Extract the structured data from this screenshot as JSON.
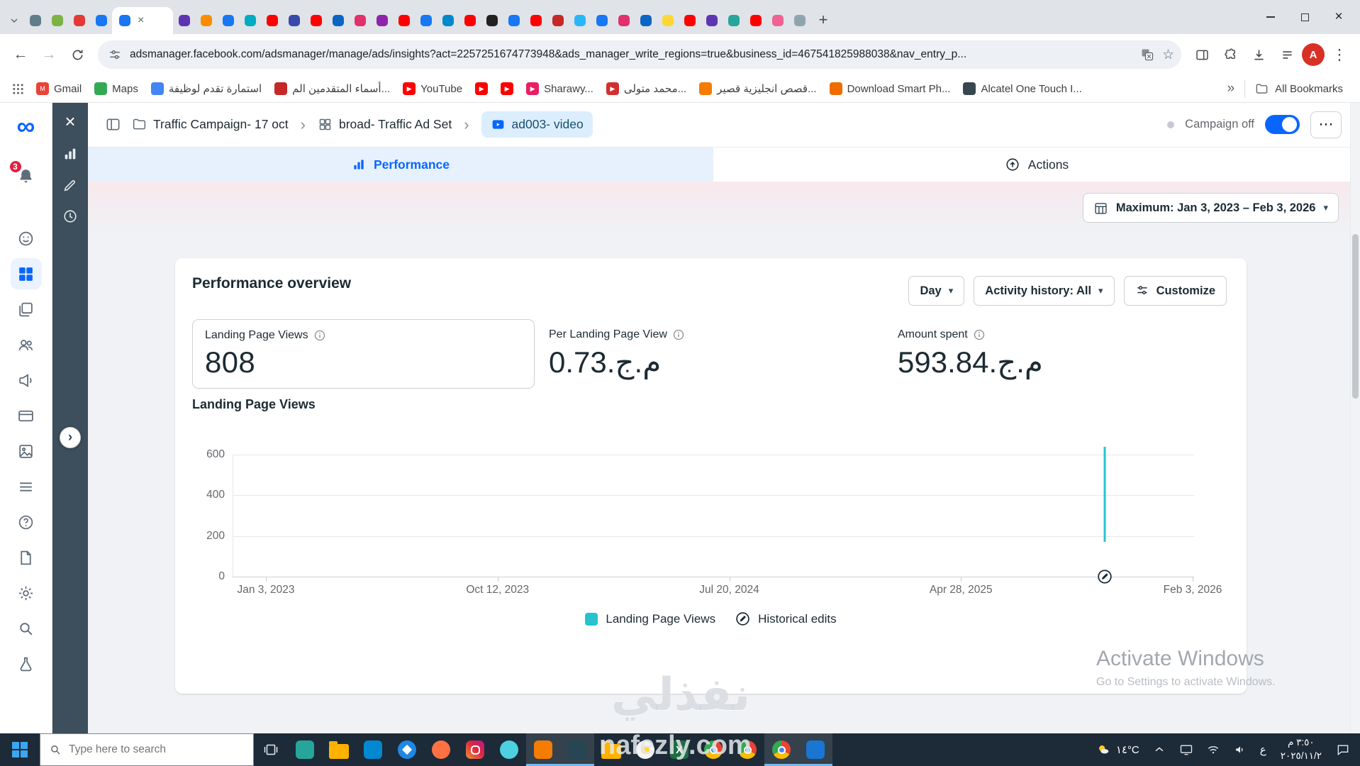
{
  "ui": {
    "icons": {
      "back": "←",
      "forward": "→",
      "star": "☆",
      "menu_v": "⋮",
      "menu_h": "⋯",
      "caret": "▾",
      "chevron": "›",
      "plus": "+",
      "close": "×",
      "overflow": "»"
    }
  },
  "browser": {
    "url": "adsmanager.facebook.com/adsmanager/manage/ads/insights?act=2257251674773948&ads_manager_write_regions=true&business_id=467541825988038&nav_entry_p...",
    "profile_initial": "A",
    "active_tab_color": "#1877f2",
    "tabs_before": [
      "#607d8b",
      "#7cb342",
      "#e53935",
      "#1877f2"
    ],
    "tabs_after": [
      "#5e35b1",
      "#fb8c00",
      "#1877f2",
      "#00acc1",
      "#ff0000",
      "#3949ab",
      "#ff0000",
      "#0a66c2",
      "#e1306c",
      "#8e24aa",
      "#ff0000",
      "#1877f2",
      "#0088cc",
      "#ff0000",
      "#212121",
      "#1877f2",
      "#ff0000",
      "#c62828",
      "#29b6f6",
      "#1877f2",
      "#e1306c",
      "#0a66c2",
      "#fdd835",
      "#ff0000",
      "#5e35b1",
      "#26a69a",
      "#ff0000",
      "#f06292",
      "#90a4ae"
    ]
  },
  "bookmarks": {
    "items": [
      {
        "label": "Gmail",
        "color": "#ea4335",
        "glyph": "M"
      },
      {
        "label": "Maps",
        "color": "#34a853",
        "glyph": ""
      },
      {
        "label": "استمارة تقدم لوظيفة",
        "color": "#4285f4",
        "glyph": ""
      },
      {
        "label": "أسماء المتقدمين الم...",
        "color": "#c62828",
        "glyph": ""
      },
      {
        "label": "YouTube",
        "color": "#ff0000",
        "glyph": "▶"
      },
      {
        "label": "",
        "color": "#ff0000",
        "glyph": "▶"
      },
      {
        "label": "",
        "color": "#ff0000",
        "glyph": "▶"
      },
      {
        "label": "Sharawy...",
        "color": "#e91e63",
        "glyph": "▶"
      },
      {
        "label": "محمد متولى...",
        "color": "#d32f2f",
        "glyph": "▶"
      },
      {
        "label": "قصص انجليزية قصير...",
        "color": "#f57c00",
        "glyph": ""
      },
      {
        "label": "Download Smart Ph...",
        "color": "#ef6c00",
        "glyph": ""
      },
      {
        "label": "Alcatel One Touch I...",
        "color": "#37474f",
        "glyph": ""
      }
    ],
    "overflow": "»",
    "all_bookmarks": "All Bookmarks"
  },
  "sidebar": {
    "logo_glyph": "∞",
    "notification_badge": "3",
    "help_glyph": "?"
  },
  "ads_manager": {
    "breadcrumb": {
      "campaign": "Traffic Campaign- 17 oct",
      "adset": "broad- Traffic Ad Set",
      "ad": "ad003- video"
    },
    "campaign_status": "Campaign off",
    "performance_tab": "Performance",
    "actions_label": "Actions",
    "date_range": "Maximum: Jan 3, 2023 – Feb 3, 2026",
    "overview": {
      "title": "Performance overview",
      "interval": "Day",
      "activity_history": "Activity history: All",
      "customize": "Customize",
      "metrics": [
        {
          "label": "Landing Page Views",
          "value": "808",
          "currency": ""
        },
        {
          "label": "Per Landing Page View",
          "value": "0.73",
          "currency": ".ج.م"
        },
        {
          "label": "Amount spent",
          "value": "593.84",
          "currency": ".ج.م"
        }
      ],
      "section_title": "Landing Page Views"
    }
  },
  "chart_data": {
    "type": "line",
    "title": "Landing Page Views",
    "x_ticks": [
      "Jan 3, 2023",
      "Oct 12, 2023",
      "Jul 20, 2024",
      "Apr 28, 2025",
      "Feb 3, 2026"
    ],
    "y_ticks": [
      0,
      200,
      400,
      600
    ],
    "ylim": [
      0,
      660
    ],
    "grid": true,
    "legend_position": "bottom",
    "series": [
      {
        "name": "Landing Page Views",
        "color": "#27c3cd",
        "description": "flat at 0 across the full date range with a single one-day spike",
        "spike": {
          "x_fraction": 0.907,
          "peak": 640,
          "visible_bottom": 170
        }
      }
    ],
    "legend": [
      {
        "label": "Landing Page Views",
        "type": "swatch"
      },
      {
        "label": "Historical edits",
        "type": "edit-icon"
      }
    ]
  },
  "activate": {
    "title": "Activate Windows",
    "subtitle": "Go to Settings to activate Windows."
  },
  "watermark": {
    "text": "نفذلي",
    "domain": "nafezly.com"
  },
  "taskbar": {
    "search_placeholder": "Type here to search",
    "weather": "١٤°C",
    "lang": "ع",
    "time": "٣:٥٠ م",
    "date": "٢٠٢٥/١١/٢",
    "icons": [
      {
        "kind": "task-view"
      },
      {
        "kind": "solid",
        "color": "#26a69a"
      },
      {
        "kind": "folder"
      },
      {
        "kind": "solid",
        "color": "#0288d1"
      },
      {
        "kind": "compass"
      },
      {
        "kind": "solid",
        "color": "#ff7043",
        "round": true
      },
      {
        "kind": "instagram"
      },
      {
        "kind": "solid",
        "color": "#4dd0e1",
        "round": true
      },
      {
        "kind": "solid",
        "color": "#f57c00",
        "active": true
      },
      {
        "kind": "solid",
        "color": "#264653",
        "active": true
      },
      {
        "kind": "folder"
      },
      {
        "kind": "bulb"
      },
      {
        "kind": "excel",
        "glyph": "X"
      },
      {
        "kind": "chrome"
      },
      {
        "kind": "chrome"
      },
      {
        "kind": "chrome",
        "active": true
      },
      {
        "kind": "solid",
        "color": "#1976d2",
        "active": true
      }
    ]
  }
}
